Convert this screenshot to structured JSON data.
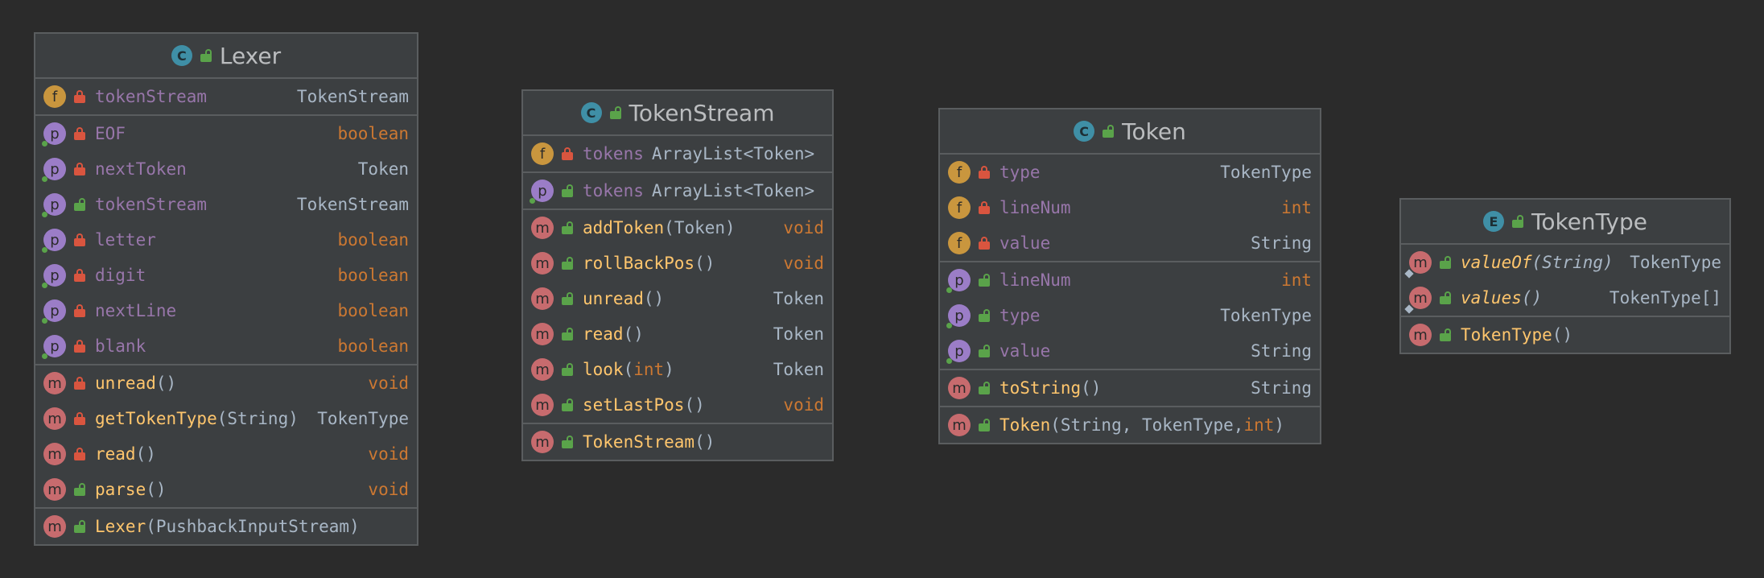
{
  "diagram": {
    "classes": [
      {
        "kind_letter": "C",
        "name": "Lexer",
        "sections": [
          [
            {
              "icon": "f",
              "access": "private",
              "name": "tokenStream",
              "name_style": "field",
              "type": "TokenStream",
              "type_style": "plain"
            }
          ],
          [
            {
              "icon": "p",
              "access": "private",
              "name": "EOF",
              "name_style": "field",
              "type": "boolean",
              "type_style": "kw",
              "override": true
            },
            {
              "icon": "p",
              "access": "private",
              "name": "nextToken",
              "name_style": "field",
              "type": "Token",
              "type_style": "plain",
              "override": true
            },
            {
              "icon": "p",
              "access": "public",
              "name": "tokenStream",
              "name_style": "field",
              "type": "TokenStream",
              "type_style": "plain",
              "override": true
            },
            {
              "icon": "p",
              "access": "private",
              "name": "letter",
              "name_style": "field",
              "type": "boolean",
              "type_style": "kw",
              "override": true
            },
            {
              "icon": "p",
              "access": "private",
              "name": "digit",
              "name_style": "field",
              "type": "boolean",
              "type_style": "kw",
              "override": true
            },
            {
              "icon": "p",
              "access": "private",
              "name": "nextLine",
              "name_style": "field",
              "type": "boolean",
              "type_style": "kw",
              "override": true
            },
            {
              "icon": "p",
              "access": "private",
              "name": "blank",
              "name_style": "field",
              "type": "boolean",
              "type_style": "kw",
              "override": true
            }
          ],
          [
            {
              "icon": "m",
              "access": "private",
              "name": "unread",
              "params": "()",
              "name_style": "method",
              "type": "void",
              "type_style": "kw"
            },
            {
              "icon": "m",
              "access": "private",
              "name": "getTokenType",
              "params": "(String)",
              "name_style": "method",
              "type": "TokenType",
              "type_style": "plain"
            },
            {
              "icon": "m",
              "access": "private",
              "name": "read",
              "params": "()",
              "name_style": "method",
              "type": "void",
              "type_style": "kw"
            },
            {
              "icon": "m",
              "access": "public",
              "name": "parse",
              "params": "()",
              "name_style": "method",
              "type": "void",
              "type_style": "kw"
            }
          ],
          [
            {
              "icon": "m",
              "access": "public",
              "name": "Lexer",
              "params": "(PushbackInputStream)",
              "name_style": "method",
              "type": "",
              "type_style": "plain"
            }
          ]
        ]
      },
      {
        "kind_letter": "C",
        "name": "TokenStream",
        "sections": [
          [
            {
              "icon": "f",
              "access": "private",
              "name": "tokens",
              "name_style": "field",
              "type": "ArrayList<Token>",
              "type_style": "plain",
              "inline": true
            }
          ],
          [
            {
              "icon": "p",
              "access": "public",
              "name": "tokens",
              "name_style": "field",
              "type": "ArrayList<Token>",
              "type_style": "plain",
              "inline": true,
              "override": true
            }
          ],
          [
            {
              "icon": "m",
              "access": "public",
              "name": "addToken",
              "params": "(Token)",
              "name_style": "method",
              "type": "void",
              "type_style": "kw"
            },
            {
              "icon": "m",
              "access": "public",
              "name": "rollBackPos",
              "params": "()",
              "name_style": "method",
              "type": "void",
              "type_style": "kw"
            },
            {
              "icon": "m",
              "access": "public",
              "name": "unread",
              "params": "()",
              "name_style": "method",
              "type": "Token",
              "type_style": "plain"
            },
            {
              "icon": "m",
              "access": "public",
              "name": "read",
              "params": "()",
              "name_style": "method",
              "type": "Token",
              "type_style": "plain"
            },
            {
              "icon": "m",
              "access": "public",
              "name": "look",
              "params_pre": "(",
              "params_kw": "int",
              "params_post": ")",
              "name_style": "method",
              "type": "Token",
              "type_style": "plain"
            },
            {
              "icon": "m",
              "access": "public",
              "name": "setLastPos",
              "params": "()",
              "name_style": "method",
              "type": "void",
              "type_style": "kw"
            }
          ],
          [
            {
              "icon": "m",
              "access": "public",
              "name": "TokenStream",
              "params": "()",
              "name_style": "method",
              "type": "",
              "type_style": "plain"
            }
          ]
        ]
      },
      {
        "kind_letter": "C",
        "name": "Token",
        "sections": [
          [
            {
              "icon": "f",
              "access": "private",
              "name": "type",
              "name_style": "field",
              "type": "TokenType",
              "type_style": "plain"
            },
            {
              "icon": "f",
              "access": "private",
              "name": "lineNum",
              "name_style": "field",
              "type": "int",
              "type_style": "kw"
            },
            {
              "icon": "f",
              "access": "private",
              "name": "value",
              "name_style": "field",
              "type": "String",
              "type_style": "plain"
            }
          ],
          [
            {
              "icon": "p",
              "access": "public",
              "name": "lineNum",
              "name_style": "field",
              "type": "int",
              "type_style": "kw",
              "override": true
            },
            {
              "icon": "p",
              "access": "public",
              "name": "type",
              "name_style": "field",
              "type": "TokenType",
              "type_style": "plain",
              "override": true
            },
            {
              "icon": "p",
              "access": "public",
              "name": "value",
              "name_style": "field",
              "type": "String",
              "type_style": "plain",
              "override": true
            }
          ],
          [
            {
              "icon": "m",
              "access": "public",
              "name": "toString",
              "params": "()",
              "name_style": "method",
              "type": "String",
              "type_style": "plain"
            }
          ],
          [
            {
              "icon": "m",
              "access": "public",
              "name": "Token",
              "params_pre": "(String, TokenType, ",
              "params_kw": "int",
              "params_post": ")",
              "name_style": "method",
              "type": "",
              "type_style": "plain"
            }
          ]
        ]
      },
      {
        "kind_letter": "E",
        "name": "TokenType",
        "sections": [
          [
            {
              "icon": "m",
              "access": "public",
              "name": "valueOf",
              "params": "(String)",
              "name_style": "method",
              "italic": true,
              "static": true,
              "type": "TokenType",
              "type_style": "plain"
            },
            {
              "icon": "m",
              "access": "public",
              "name": "values",
              "params": "()",
              "name_style": "method",
              "italic": true,
              "static": true,
              "type": "TokenType[]",
              "type_style": "plain"
            }
          ],
          [
            {
              "icon": "m",
              "access": "public",
              "name": "TokenType",
              "params": "()",
              "name_style": "method",
              "type": "",
              "type_style": "plain"
            }
          ]
        ]
      }
    ]
  },
  "icons": {
    "f": "field-icon",
    "p": "property-icon",
    "m": "method-icon"
  },
  "colors": {
    "background": "#2b2b2b",
    "box": "#3c3f41",
    "field_name": "#9876aa",
    "method_name": "#ffc66d",
    "keyword": "#cc7832",
    "plain_text": "#a9b7c6",
    "private_lock": "#d9553f",
    "public_lock": "#5aa34a"
  }
}
